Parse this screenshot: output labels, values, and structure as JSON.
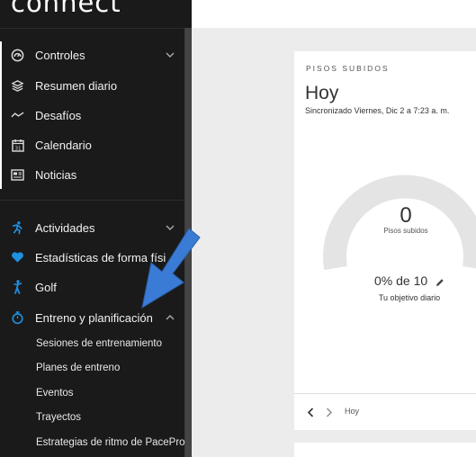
{
  "app": {
    "logo": "connect"
  },
  "sidebar": {
    "items": [
      {
        "label": "Controles",
        "icon": "dashboard-icon",
        "expandable": true,
        "expanded": false
      },
      {
        "label": "Resumen diario",
        "icon": "layers-icon"
      },
      {
        "label": "Desafíos",
        "icon": "trend-icon"
      },
      {
        "label": "Calendario",
        "icon": "calendar-icon"
      },
      {
        "label": "Noticias",
        "icon": "news-icon"
      },
      {
        "label": "Actividades",
        "icon": "runner-icon",
        "expandable": true,
        "expanded": false
      },
      {
        "label": "Estadísticas de forma físi",
        "icon": "heart-icon"
      },
      {
        "label": "Golf",
        "icon": "golfer-icon"
      },
      {
        "label": "Entreno y planificación",
        "icon": "stopwatch-icon",
        "expandable": true,
        "expanded": true
      }
    ],
    "subitems": [
      {
        "label": "Sesiones de entrenamiento"
      },
      {
        "label": "Planes de entreno"
      },
      {
        "label": "Eventos"
      },
      {
        "label": "Trayectos"
      },
      {
        "label": "Estrategias de ritmo de PacePro"
      }
    ]
  },
  "card": {
    "title": "PISOS SUBIDOS",
    "period": "Hoy",
    "sync": "Sincronizado Viernes, Dic 2 a 7:23 a. m.",
    "value": "0",
    "value_label": "Pisos subidos",
    "goal": "0% de 10",
    "goal_label": "Tu objetivo diario",
    "pager_label": "Hoy",
    "progress_fraction": 0
  },
  "colors": {
    "sidebar_bg": "#1a1a1a",
    "accent_blue": "#1e90e0",
    "arrow_blue": "#3a7bd5",
    "gauge_track": "#e4e4e4"
  }
}
